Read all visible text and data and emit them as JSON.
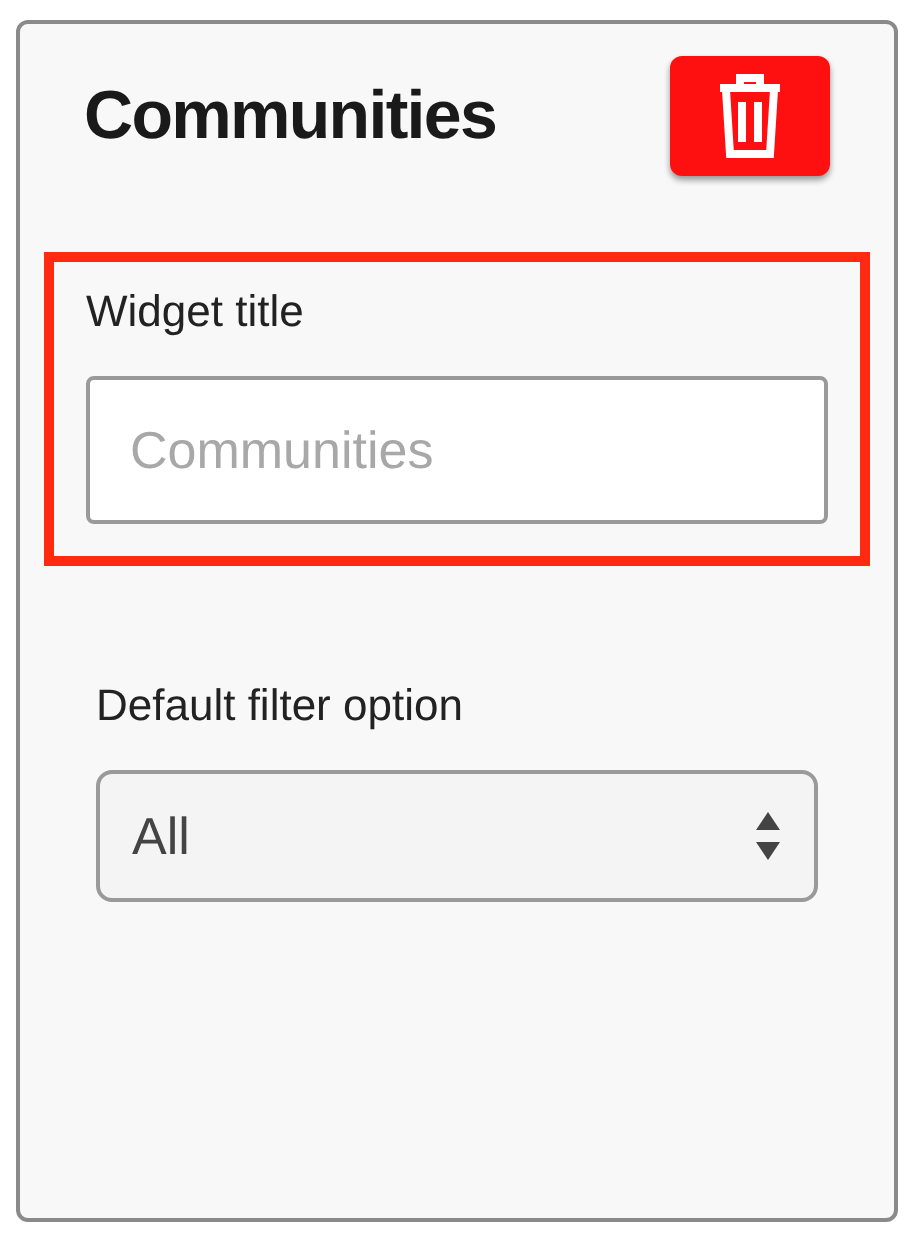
{
  "panel": {
    "title": "Communities",
    "delete_button": {
      "kind": "trash"
    }
  },
  "fields": [
    {
      "kind": "text",
      "label": "Widget title",
      "placeholder": "Communities",
      "highlighted": true
    },
    {
      "kind": "select",
      "label": "Default filter option",
      "value": "All",
      "highlighted": false
    }
  ]
}
